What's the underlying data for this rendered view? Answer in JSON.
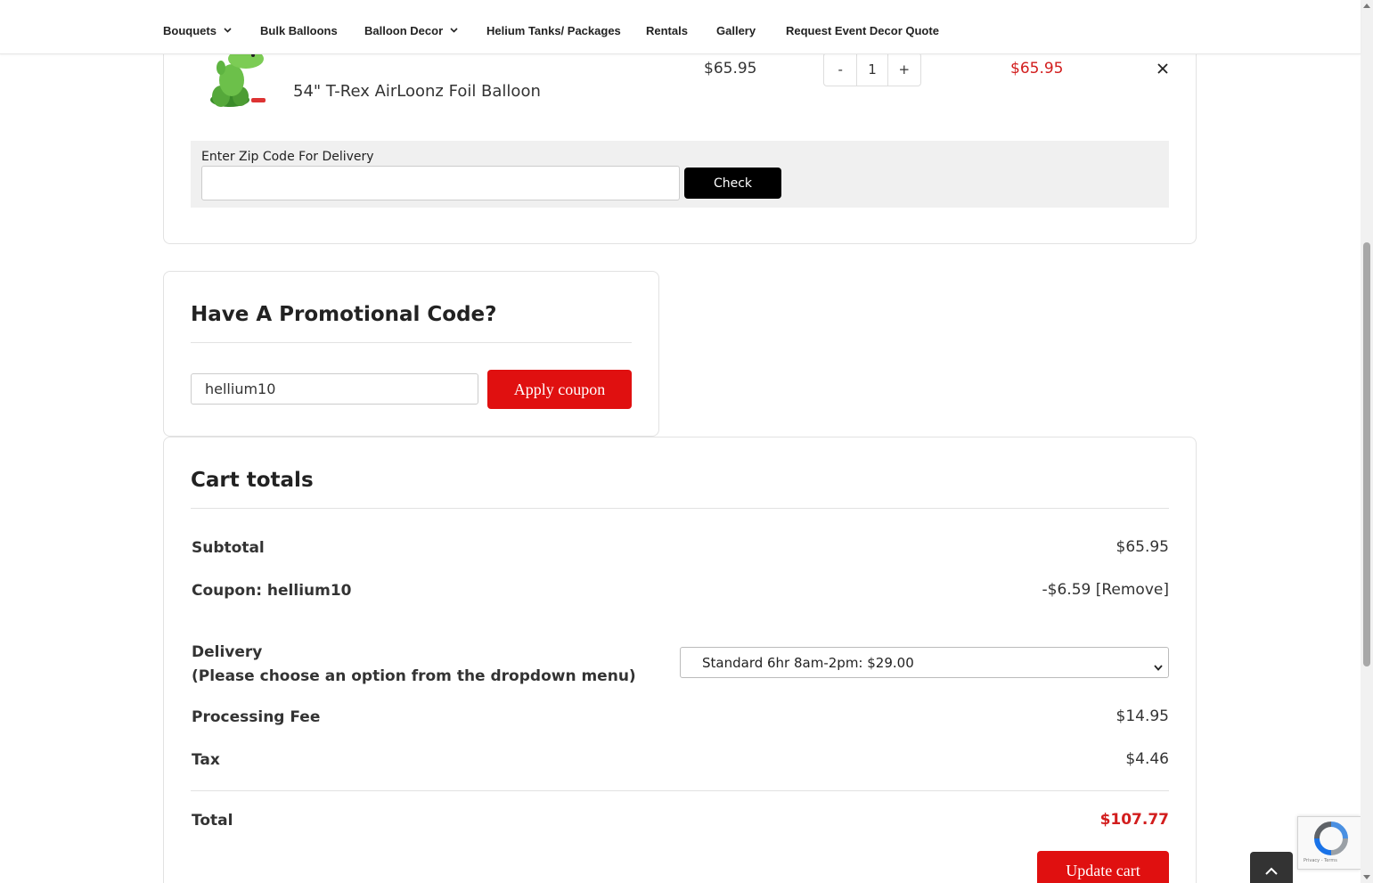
{
  "nav": {
    "items": [
      {
        "label": "Bouquets",
        "has_dropdown": true
      },
      {
        "label": "Bulk Balloons",
        "has_dropdown": false
      },
      {
        "label": "Balloon Decor",
        "has_dropdown": true
      },
      {
        "label": "Helium Tanks/ Packages",
        "has_dropdown": false
      },
      {
        "label": "Rentals",
        "has_dropdown": false
      },
      {
        "label": "Gallery",
        "has_dropdown": false
      },
      {
        "label": "Request Event Decor Quote",
        "has_dropdown": false
      }
    ]
  },
  "cart_item": {
    "name": "54\" T-Rex AirLoonz Foil Balloon",
    "price": "$65.95",
    "quantity": "1",
    "qty_minus": "-",
    "qty_plus": "+",
    "line_total": "$65.95",
    "remove_icon": "close-icon"
  },
  "zip": {
    "label": "Enter Zip Code For Delivery",
    "value": "",
    "button": "Check"
  },
  "promo": {
    "title": "Have A Promotional Code?",
    "code_value": "hellium10",
    "apply_label": "Apply coupon"
  },
  "totals": {
    "title": "Cart totals",
    "subtotal_label": "Subtotal",
    "subtotal_value": "$65.95",
    "coupon_label": "Coupon: hellium10",
    "coupon_value": "-$6.59 [Remove]",
    "delivery_label_line1": "Delivery",
    "delivery_label_line2": "(Please choose an option from the dropdown menu)",
    "delivery_selected": "Standard 6hr 8am-2pm: $29.00",
    "processing_label": "Processing Fee",
    "processing_value": "$14.95",
    "tax_label": "Tax",
    "tax_value": "$4.46",
    "total_label": "Total",
    "total_value": "$107.77",
    "update_label": "Update cart"
  },
  "recaptcha": {
    "footer_text": "Privacy - Terms"
  },
  "colors": {
    "accent_red": "#e01010",
    "price_red": "#d21d1d",
    "black_button": "#000000"
  }
}
